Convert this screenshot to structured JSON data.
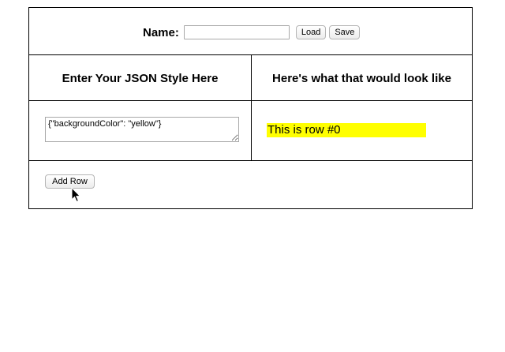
{
  "name_bar": {
    "label": "Name:",
    "input_value": "",
    "load_label": "Load",
    "save_label": "Save"
  },
  "headers": {
    "left": "Enter Your JSON Style Here",
    "right": "Here's what that would look like"
  },
  "rows": [
    {
      "style_json": "{\"backgroundColor\": \"yellow\"}",
      "preview_text": "This is row #0",
      "preview_background": "#ffff00"
    }
  ],
  "actions": {
    "add_row_label": "Add Row"
  },
  "icons": {
    "cursor": "arrow-pointer-icon",
    "resize": "resize-grip-icon"
  }
}
